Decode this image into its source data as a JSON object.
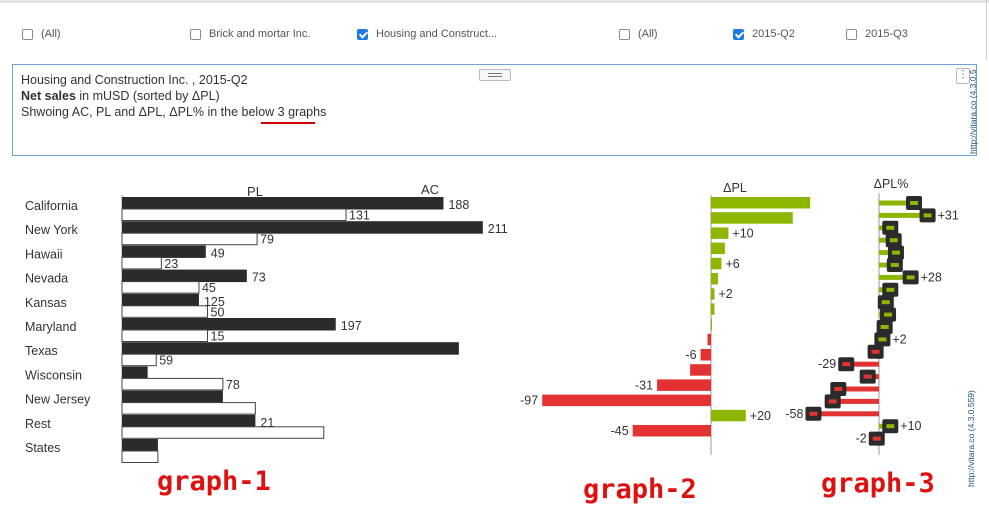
{
  "filters": [
    {
      "label": "(All)",
      "checked": false
    },
    {
      "label": "Brick and mortar Inc.",
      "checked": false
    },
    {
      "label": "Housing and Construct...",
      "checked": true
    },
    {
      "label": "(All)",
      "checked": false
    },
    {
      "label": "2015-Q2",
      "checked": true
    },
    {
      "label": "2015-Q3",
      "checked": false
    }
  ],
  "textbox": {
    "line1": "Housing and Construction Inc. , 2015-Q2",
    "line2_bold": "Net sales",
    "line2_rest": " in mUSD (sorted by ΔPL)",
    "line3_pre": "Shwoing AC, PL and ΔPL, ΔPL% in the below ",
    "line3_under": "3 graphs",
    "kebab": "⋮",
    "watermark_top": "http://vitara.co  (4.3.0.5",
    "watermark_bottom": "http://vitara.co  (4.3.0.559)"
  },
  "annotations": {
    "g1": "graph-1",
    "g2": "graph-2",
    "g3": "graph-3"
  },
  "colors": {
    "dark": "#2b2b2b",
    "pos": "#8db600",
    "neg": "#e33232",
    "accent": "#1f7ae0",
    "annotation": "#e01010"
  },
  "chart_data": {
    "type": "bar",
    "categories": [
      "California",
      "New York",
      "Hawaii",
      "Nevada",
      "Kansas",
      "Maryland",
      "Texas",
      "Wisconsin",
      "New Jersey",
      "Rest",
      "States"
    ],
    "graph1": {
      "headers": [
        "PL",
        "AC"
      ],
      "ac": [
        188,
        211,
        49,
        73,
        45,
        125,
        197,
        15,
        59,
        78,
        21
      ],
      "pl": [
        131,
        79,
        23,
        45,
        50,
        50,
        20,
        59,
        78,
        118,
        21
      ],
      "labels": [
        {
          "row": 0,
          "text": "188",
          "pos": "ac"
        },
        {
          "row": 0,
          "text": "131",
          "pos": "pl"
        },
        {
          "row": 1,
          "text": "211",
          "pos": "ac"
        },
        {
          "row": 1,
          "text": "79",
          "pos": "pl"
        },
        {
          "row": 2,
          "text": "49",
          "pos": "ac"
        },
        {
          "row": 2,
          "text": "23",
          "pos": "pl"
        },
        {
          "row": 3,
          "text": "73",
          "pos": "ac"
        },
        {
          "row": 3,
          "text": "45",
          "pos": "pl"
        },
        {
          "row": 4,
          "text": "125",
          "pos": "ac"
        },
        {
          "row": 4,
          "text": "50",
          "pos": "pl"
        },
        {
          "row": 5,
          "text": "197",
          "pos": "ac"
        },
        {
          "row": 5,
          "text": "15",
          "pos": "pl"
        },
        {
          "row": 6,
          "text": "59",
          "pos": "pl"
        },
        {
          "row": 7,
          "text": "78",
          "pos": "pl"
        },
        {
          "row": 9,
          "text": "21",
          "pos": "ac"
        }
      ]
    },
    "graph2": {
      "header": "ΔPL",
      "values": [
        57,
        47,
        10,
        8,
        6,
        4,
        2,
        2,
        0,
        -2,
        -6,
        -12,
        -31,
        -97,
        20,
        -45
      ],
      "labels": [
        {
          "index": 2,
          "text": "+10"
        },
        {
          "index": 4,
          "text": "+6"
        },
        {
          "index": 6,
          "text": "+2"
        },
        {
          "index": 10,
          "text": "-6"
        },
        {
          "index": 12,
          "text": "-31"
        },
        {
          "index": 13,
          "text": "-97"
        },
        {
          "index": 14,
          "text": "+20"
        },
        {
          "index": 15,
          "text": "-45"
        }
      ]
    },
    "graph3": {
      "header": "ΔPL%",
      "values": [
        31,
        43,
        10,
        13,
        15,
        14,
        28,
        10,
        6,
        8,
        5,
        3,
        -3,
        -29,
        -10,
        -36,
        -41,
        -58,
        10,
        -2
      ],
      "labels": [
        {
          "index": 1,
          "text": "+31"
        },
        {
          "index": 6,
          "text": "+28"
        },
        {
          "index": 11,
          "text": "+2"
        },
        {
          "index": 13,
          "text": "-29"
        },
        {
          "index": 17,
          "text": "-58"
        },
        {
          "index": 18,
          "text": "+10"
        },
        {
          "index": 19,
          "text": "-2"
        }
      ]
    }
  }
}
